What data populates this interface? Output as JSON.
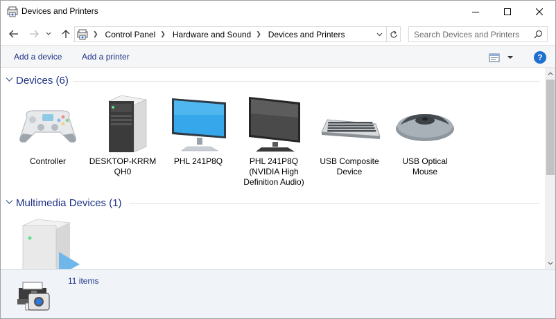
{
  "window": {
    "title": "Devices and Printers",
    "caption_buttons": [
      "minimize-icon",
      "maximize-icon",
      "close-icon"
    ]
  },
  "navigation": {
    "back_icon": "arrow-left-icon",
    "forward_icon": "arrow-right-icon",
    "recent_icon": "chevron-down-icon",
    "up_icon": "arrow-up-icon",
    "breadcrumbs": [
      "Control Panel",
      "Hardware and Sound",
      "Devices and Printers"
    ],
    "search_placeholder": "Search Devices and Printers"
  },
  "command_bar": {
    "add_device": "Add a device",
    "add_printer": "Add a printer",
    "help": "?"
  },
  "groups": [
    {
      "title": "Devices (6)",
      "items": [
        {
          "label": "Controller",
          "icon": "gamepad-icon"
        },
        {
          "label": "DESKTOP-KRRM QH0",
          "icon": "computer-tower-icon"
        },
        {
          "label": "PHL 241P8Q",
          "icon": "monitor-blue-icon"
        },
        {
          "label": "PHL 241P8Q (NVIDIA High Definition Audio)",
          "icon": "monitor-dark-icon"
        },
        {
          "label": "USB Composite Device",
          "icon": "keyboard-icon"
        },
        {
          "label": "USB Optical Mouse",
          "icon": "mouse-icon"
        }
      ]
    },
    {
      "title": "Multimedia Devices (1)",
      "items": [
        {
          "label": "",
          "icon": "media-server-icon"
        }
      ]
    }
  ],
  "details": {
    "count": "11 items",
    "icon": "devices-printers-icon"
  },
  "colors": {
    "link_text": "#1e3287",
    "help_blue": "#1f6fd1",
    "command_bar_bg": "#f5f6f7",
    "details_bg": "#f0f4f9"
  }
}
